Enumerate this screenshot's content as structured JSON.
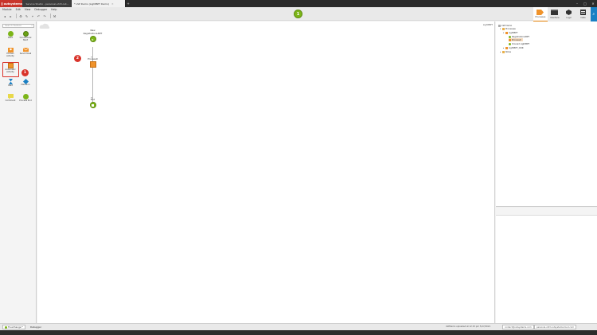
{
  "app": {
    "logo_text": "outsystems",
    "tabs": [
      {
        "label": "Service Studio - personal-uhl3.out..."
      },
      {
        "label": "* LSP Demo (LightBPT Demo)"
      }
    ],
    "window_controls": [
      "–",
      "□",
      "✕"
    ]
  },
  "menu": [
    "Module",
    "Edit",
    "View",
    "Debugger",
    "Help"
  ],
  "toolbar": {
    "badge_number": "1"
  },
  "right_nav": [
    {
      "label": "Processes",
      "active": true
    },
    {
      "label": "Interface",
      "active": false
    },
    {
      "label": "Logic",
      "active": false
    },
    {
      "label": "Data",
      "active": false
    }
  ],
  "palette": {
    "search_placeholder": "Search Toolbox",
    "items": [
      {
        "label": "Start",
        "icon": "start-icon"
      },
      {
        "label": "Conditional Start",
        "icon": "conditional-start-icon"
      },
      {
        "label": "Human Activity",
        "icon": "human-activity-icon"
      },
      {
        "label": "Send Email",
        "icon": "send-email-icon"
      },
      {
        "label": "Automatic Activity",
        "icon": "automatic-activity-icon"
      },
      {
        "label": "Wait",
        "icon": "wait-icon"
      },
      {
        "label": "Decision",
        "icon": "decision-icon"
      },
      {
        "label": "Comment",
        "icon": "comment-icon"
      },
      {
        "label": "Process End",
        "icon": "process-end-icon"
      }
    ],
    "highlight_badge": "1"
  },
  "canvas": {
    "label": "LightBPT",
    "nodes": {
      "start": {
        "label_line1": "New",
        "label_line2": "RegistrationLBPT"
      },
      "activity": {
        "label": "Process0"
      },
      "end": {
        "label": "End"
      }
    },
    "activity_badge": "2"
  },
  "tree": {
    "rows": [
      {
        "label": "LSP Demo",
        "indent": 0,
        "icon": "grey"
      },
      {
        "label": "Processes",
        "indent": 1,
        "icon": "folder"
      },
      {
        "label": "LightBPT",
        "indent": 2,
        "icon": "orange"
      },
      {
        "label": "RegistrationLBPT",
        "indent": 3,
        "icon": "green"
      },
      {
        "label": "Process0",
        "indent": 3,
        "icon": "orange",
        "selected": true
      },
      {
        "label": "OnLoad LightBPT",
        "indent": 3,
        "icon": "green"
      },
      {
        "label": "LightBPT_OOR",
        "indent": 2,
        "icon": "orange"
      },
      {
        "label": "Roles",
        "indent": 1,
        "icon": "folder"
      }
    ]
  },
  "bottom": {
    "tabs": [
      {
        "label": "TrueChange™",
        "active": true
      },
      {
        "label": "Debugger",
        "active": false
      }
    ],
    "status_text": "LSPDemo uploaded at 12:15 pm 5/17/2021",
    "user": "contact@outsystems.com",
    "server": "personal-uhl3.outsystemscloud.com"
  }
}
